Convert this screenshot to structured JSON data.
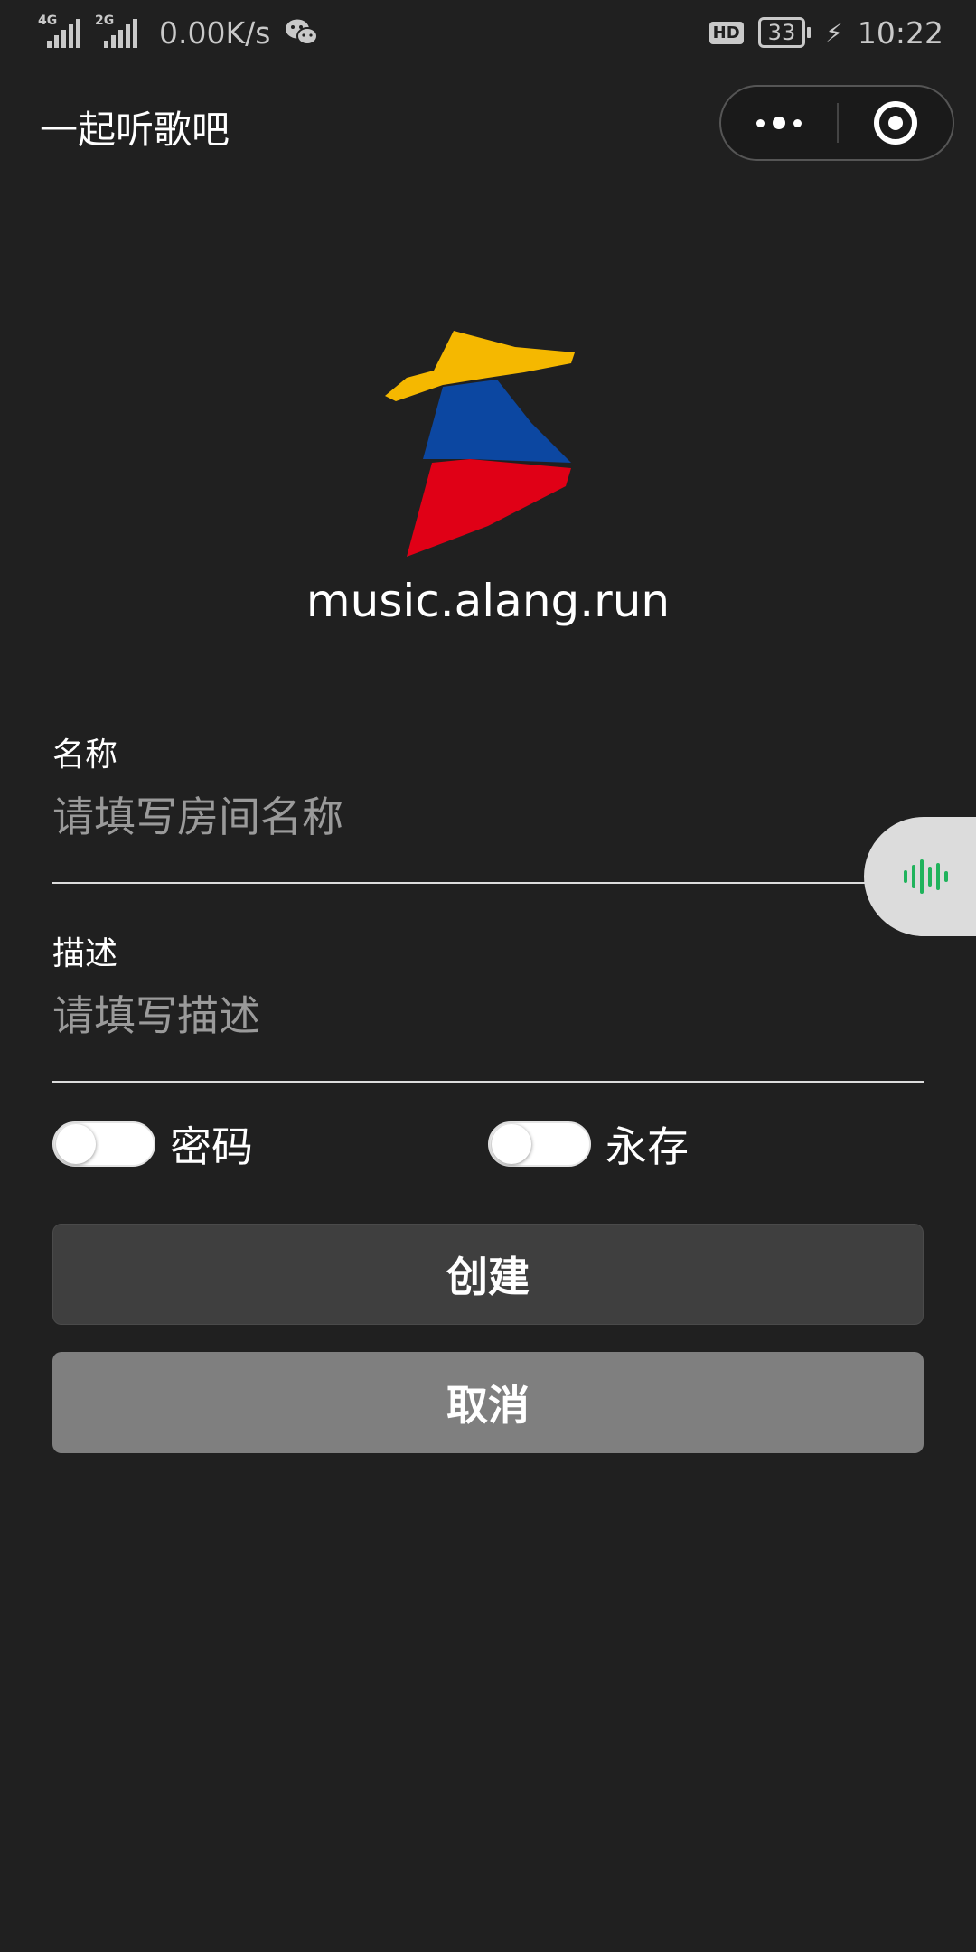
{
  "status_bar": {
    "network_1": "4G",
    "network_2": "2G",
    "speed": "0.00K/s",
    "app_icon": "wechat-icon",
    "hd": "HD",
    "battery": "33",
    "time": "10:22"
  },
  "nav": {
    "title": "一起听歌吧",
    "more_icon": "more-dots-icon",
    "close_icon": "target-circle-icon"
  },
  "logo": {
    "icon": "music-logo",
    "colors": [
      "#f5b800",
      "#0c47a1",
      "#e00016"
    ],
    "site": "music.alang.run"
  },
  "form": {
    "name_label": "名称",
    "name_placeholder": "请填写房间名称",
    "name_value": "",
    "desc_label": "描述",
    "desc_placeholder": "请填写描述",
    "desc_value": "",
    "password_label": "密码",
    "password_on": false,
    "permanent_label": "永存",
    "permanent_on": false
  },
  "buttons": {
    "create": "创建",
    "cancel": "取消"
  },
  "floating": {
    "icon": "audio-wave-icon",
    "accent": "#20b35c"
  }
}
